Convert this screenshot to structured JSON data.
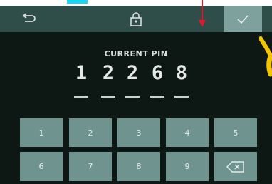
{
  "header": {
    "back_icon": "back-arrow-icon",
    "lock_icon": "lock-icon",
    "confirm_icon": "check-icon"
  },
  "pin": {
    "title": "CURRENT PIN",
    "digits": [
      "1",
      "2",
      "2",
      "6",
      "8"
    ]
  },
  "keypad": {
    "row1": [
      "1",
      "2",
      "3",
      "4",
      "5"
    ],
    "row2": [
      "6",
      "7",
      "8",
      "9"
    ],
    "backspace_icon": "backspace-icon"
  },
  "colors": {
    "header_bg": "#2f4d49",
    "confirm_bg": "#7fa19d",
    "key_bg": "#6f938e",
    "screen_bg": "#0d1714",
    "annotation_arrow": "#e0192a",
    "annotation_mark": "#f2c500"
  }
}
